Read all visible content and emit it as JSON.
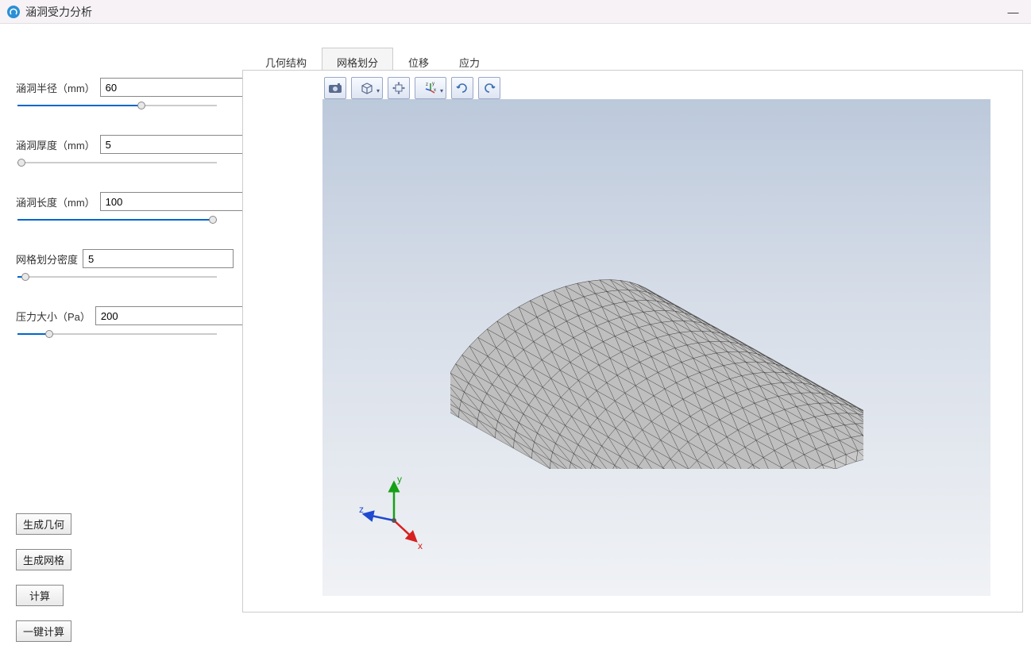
{
  "window": {
    "title": "涵洞受力分析",
    "minimize": "—"
  },
  "params": {
    "radius": {
      "label": "涵洞半径（mm）",
      "value": "60",
      "slider_pct": 62
    },
    "thickness": {
      "label": "涵洞厚度（mm）",
      "value": "5",
      "slider_pct": 2
    },
    "length": {
      "label": "涵洞长度（mm）",
      "value": "100",
      "slider_pct": 98
    },
    "mesh": {
      "label": "网格划分密度",
      "value": "5",
      "slider_pct": 4
    },
    "pressure": {
      "label": "压力大小（Pa）",
      "value": "200",
      "slider_pct": 16
    }
  },
  "actions": {
    "gen_geom": "生成几何",
    "gen_mesh": "生成网格",
    "compute": "计算",
    "one_click": "一键计算"
  },
  "tabs": {
    "geometry": "几何结构",
    "mesh": "网格划分",
    "displacement": "位移",
    "stress": "应力",
    "active": "mesh"
  },
  "toolbar_icons": {
    "camera": "camera-icon",
    "box": "box-view-icon",
    "pan": "pan-icon",
    "axes": "axes-icon",
    "rotate_ccw": "rotate-ccw-icon",
    "rotate_cw": "rotate-cw-icon"
  },
  "axes_labels": {
    "x": "x",
    "y": "y",
    "z": "z"
  }
}
